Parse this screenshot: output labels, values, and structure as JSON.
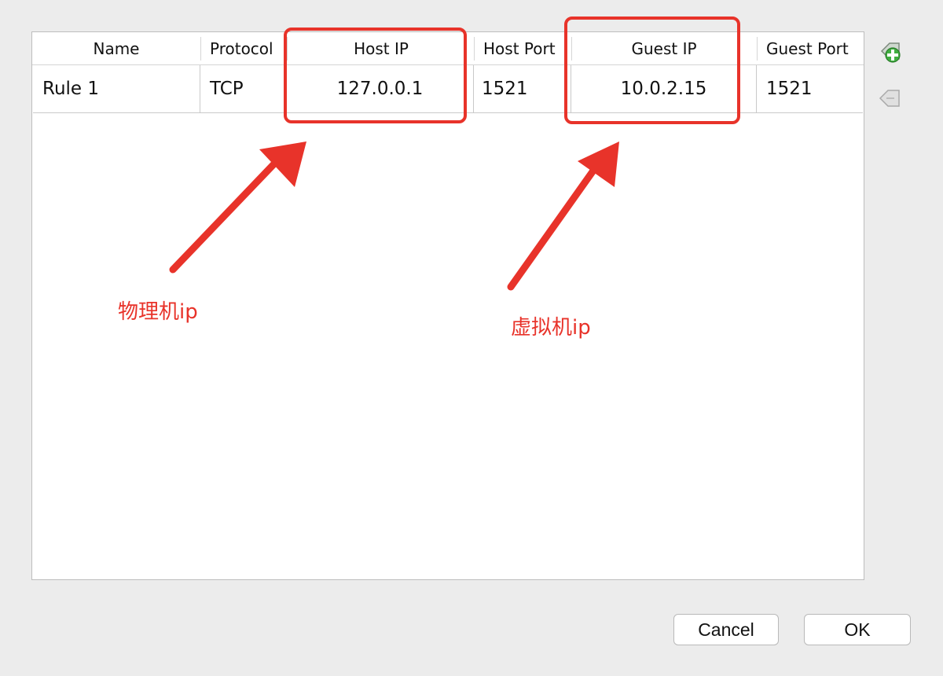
{
  "table": {
    "columns": [
      {
        "key": "name",
        "label": "Name"
      },
      {
        "key": "protocol",
        "label": "Protocol"
      },
      {
        "key": "host_ip",
        "label": "Host IP"
      },
      {
        "key": "host_port",
        "label": "Host Port"
      },
      {
        "key": "guest_ip",
        "label": "Guest IP"
      },
      {
        "key": "guest_port",
        "label": "Guest Port"
      }
    ],
    "rows": [
      {
        "name": "Rule 1",
        "protocol": "TCP",
        "host_ip": "127.0.0.1",
        "host_port": "1521",
        "guest_ip": "10.0.2.15",
        "guest_port": "1521"
      }
    ]
  },
  "toolbar": {
    "add_icon": "add-rule-icon",
    "remove_icon": "remove-rule-icon"
  },
  "annotations": {
    "host_label": "物理机ip",
    "guest_label": "虚拟机ip",
    "color": "#e8332a"
  },
  "buttons": {
    "cancel": "Cancel",
    "ok": "OK"
  }
}
